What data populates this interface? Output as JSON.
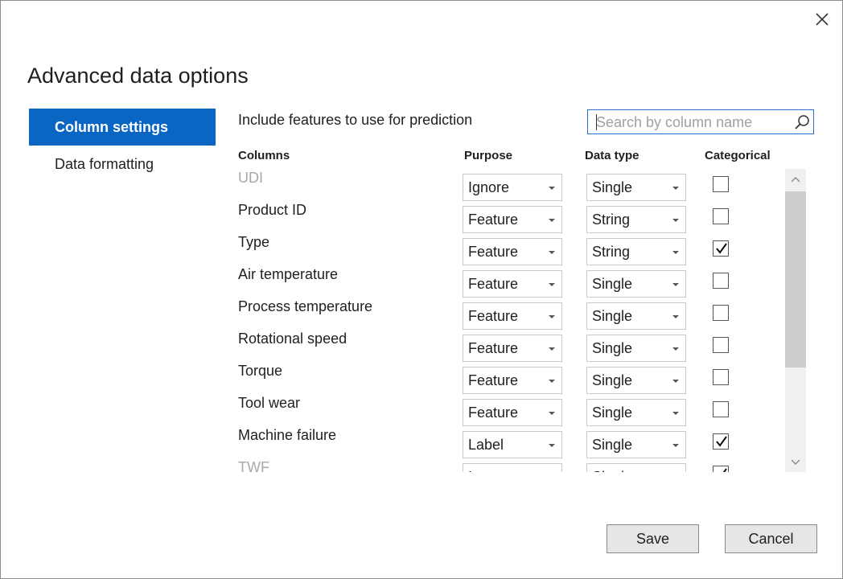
{
  "dialog": {
    "title": "Advanced data options",
    "accent_color": "#0a66c2"
  },
  "nav": {
    "items": [
      {
        "label": "Column settings",
        "active": true
      },
      {
        "label": "Data formatting",
        "active": false
      }
    ]
  },
  "content": {
    "include_label": "Include features to use for prediction",
    "search_placeholder": "Search by column name",
    "headers": {
      "columns": "Columns",
      "purpose": "Purpose",
      "data_type": "Data type",
      "categorical": "Categorical"
    },
    "rows": [
      {
        "name": "UDI",
        "purpose": "Ignore",
        "data_type": "Single",
        "categorical": false
      },
      {
        "name": "Product ID",
        "purpose": "Feature",
        "data_type": "String",
        "categorical": false
      },
      {
        "name": "Type",
        "purpose": "Feature",
        "data_type": "String",
        "categorical": true
      },
      {
        "name": "Air temperature",
        "purpose": "Feature",
        "data_type": "Single",
        "categorical": false
      },
      {
        "name": "Process temperature",
        "purpose": "Feature",
        "data_type": "Single",
        "categorical": false
      },
      {
        "name": "Rotational speed",
        "purpose": "Feature",
        "data_type": "Single",
        "categorical": false
      },
      {
        "name": "Torque",
        "purpose": "Feature",
        "data_type": "Single",
        "categorical": false
      },
      {
        "name": "Tool wear",
        "purpose": "Feature",
        "data_type": "Single",
        "categorical": false
      },
      {
        "name": "Machine failure",
        "purpose": "Label",
        "data_type": "Single",
        "categorical": true
      },
      {
        "name": "TWF",
        "purpose": "Ignore",
        "data_type": "Single",
        "categorical": true
      }
    ]
  },
  "footer": {
    "save_label": "Save",
    "cancel_label": "Cancel"
  },
  "icons": {
    "close": "close-icon",
    "search": "search-icon",
    "dropdown": "chevron-down-icon",
    "check": "checkmark-icon",
    "scroll_up": "chevron-up-icon",
    "scroll_down": "chevron-down-icon"
  }
}
